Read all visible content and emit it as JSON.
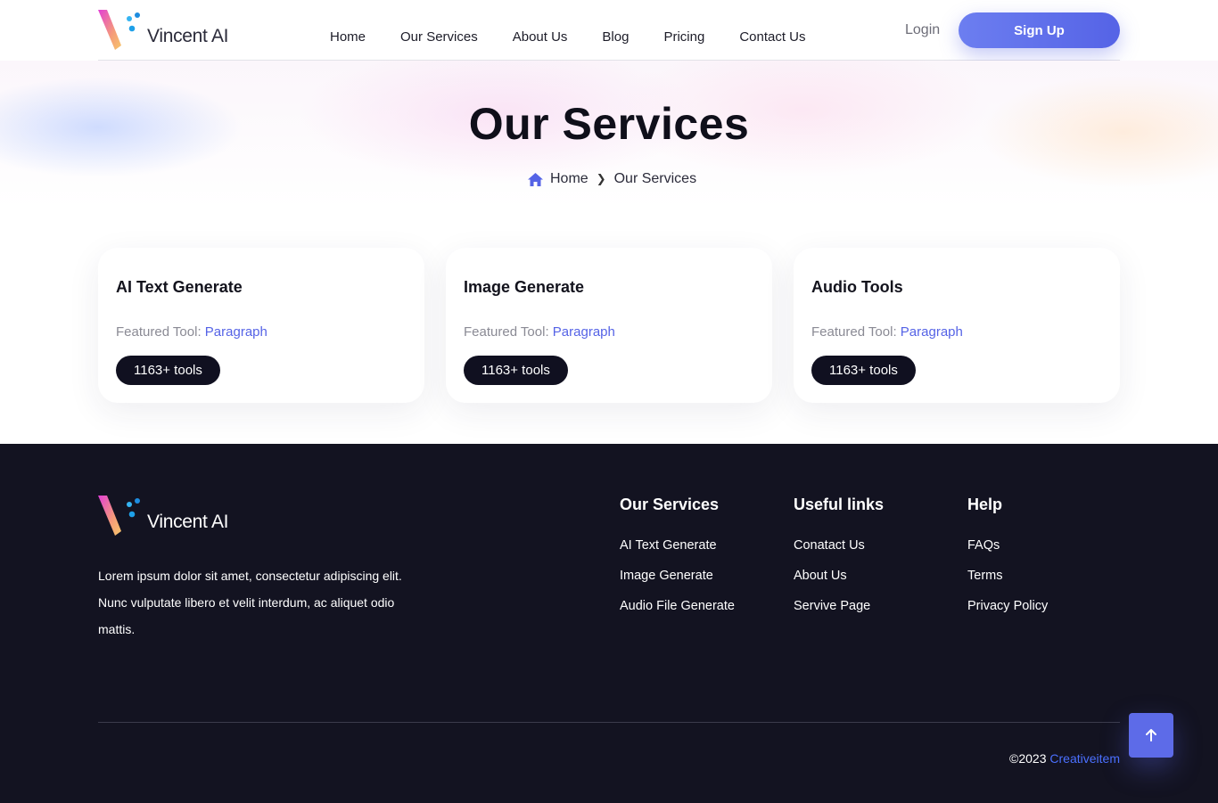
{
  "brand": {
    "name": "Vincent AI"
  },
  "nav": {
    "items": [
      "Home",
      "Our Services",
      "About Us",
      "Blog",
      "Pricing",
      "Contact Us"
    ],
    "login": "Login",
    "signup": "Sign Up"
  },
  "hero": {
    "title": "Our Services",
    "breadcrumb": {
      "home": "Home",
      "current": "Our Services"
    }
  },
  "services": [
    {
      "title": "AI Text Generate",
      "feature_label": "Featured Tool:",
      "feature_link": "Paragraph",
      "badge": "1163+ tools"
    },
    {
      "title": "Image Generate",
      "feature_label": "Featured Tool:",
      "feature_link": "Paragraph",
      "badge": "1163+ tools"
    },
    {
      "title": "Audio Tools",
      "feature_label": "Featured Tool:",
      "feature_link": "Paragraph",
      "badge": "1163+ tools"
    }
  ],
  "footer": {
    "about": "Lorem ipsum dolor sit amet, consectetur adipiscing elit. Nunc vulputate libero et velit interdum, ac aliquet odio mattis.",
    "columns": [
      {
        "title": "Our Services",
        "links": [
          "AI Text Generate",
          "Image Generate",
          "Audio File Generate"
        ]
      },
      {
        "title": "Useful links",
        "links": [
          "Conatact Us",
          "About Us",
          "Servive Page"
        ]
      },
      {
        "title": "Help",
        "links": [
          "FAQs",
          "Terms",
          "Privacy Policy"
        ]
      }
    ],
    "copyright": {
      "year": "©2023",
      "brand": "Creativeitem"
    }
  },
  "colors": {
    "accent": "#5563e6",
    "dark": "#131321",
    "badge": "#101020",
    "copyright_link": "#4b70ff"
  },
  "icons": {
    "home": "home-icon",
    "chevron": "chevron-right-icon",
    "scroll_top": "arrow-up-icon"
  }
}
